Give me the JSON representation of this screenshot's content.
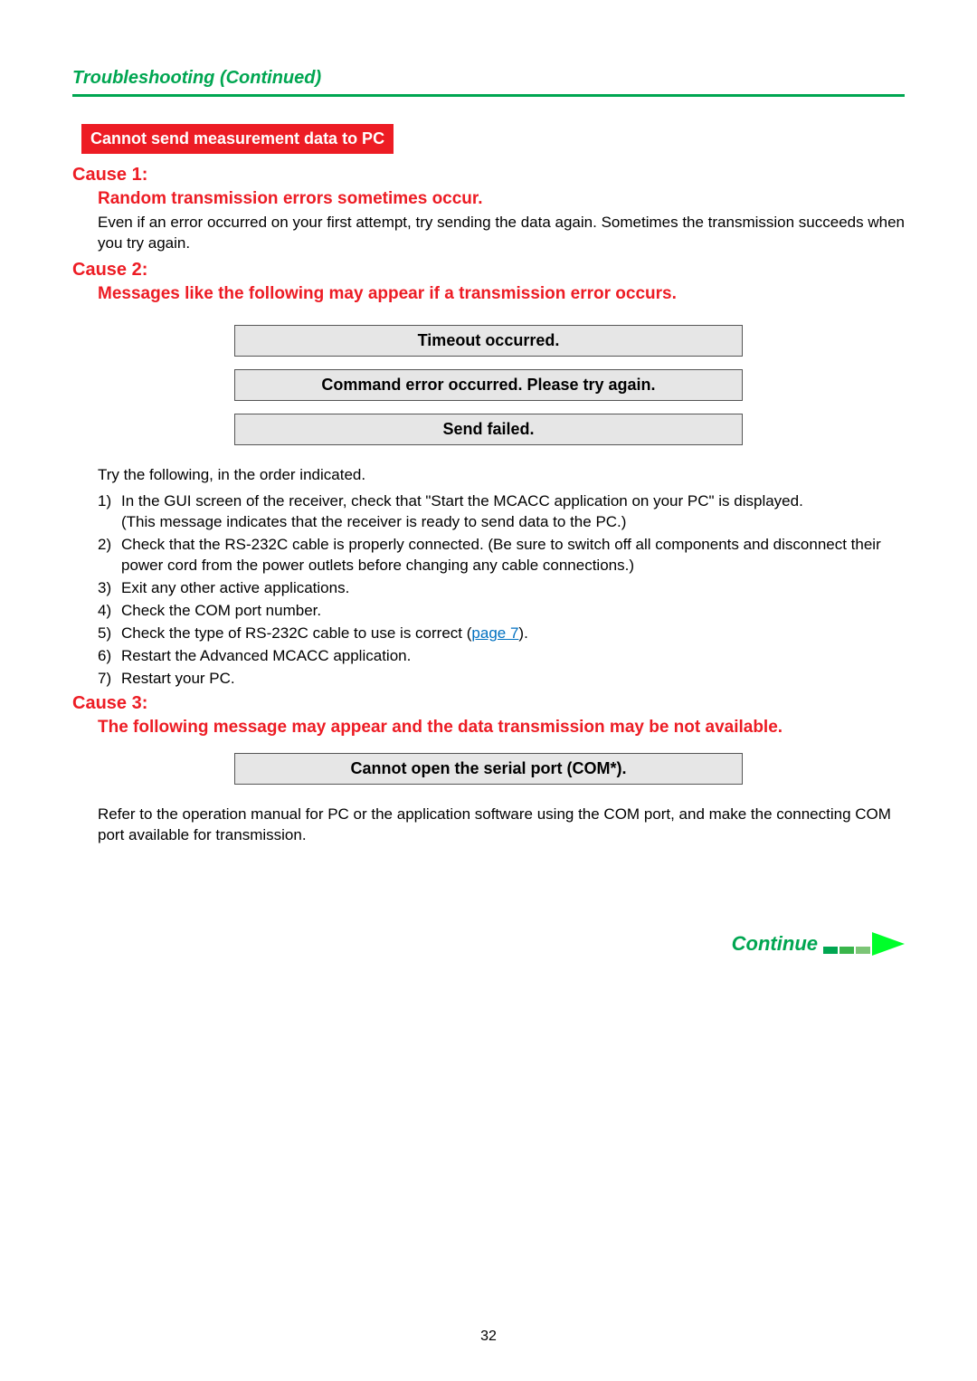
{
  "header": {
    "breadcrumb": "Troubleshooting (Continued)"
  },
  "section": {
    "title": "Cannot send measurement data to PC"
  },
  "cause1": {
    "label": "Cause 1:",
    "sub": "Random transmission errors sometimes occur.",
    "body": "Even if an error occurred on your first attempt, try sending the data again. Sometimes the transmission succeeds when you try again."
  },
  "cause2": {
    "label": "Cause 2:",
    "sub": "Messages like the following may appear if a transmission error occurs.",
    "msgs": [
      "Timeout occurred.",
      "Command error occurred. Please try again.",
      "Send failed."
    ],
    "intro": "Try the following, in the order indicated.",
    "items": [
      {
        "n": "1)",
        "text_a": "In the GUI screen of the receiver, check that \"Start the MCACC application on your PC\" is displayed.",
        "text_b": "(This message indicates that the receiver is ready to send data to the PC.)"
      },
      {
        "n": "2)",
        "text_a": "Check that the RS-232C cable is properly connected. (Be sure to switch off all components and disconnect their power cord from the power outlets before changing any cable connections.)"
      },
      {
        "n": "3)",
        "text_a": "Exit any other active applications."
      },
      {
        "n": "4)",
        "text_a": "Check the COM port number."
      },
      {
        "n": "5)",
        "text_a": "Check the type of RS-232C cable to use is correct (",
        "link": "page 7",
        "text_c": ")."
      },
      {
        "n": "6)",
        "text_a": "Restart the Advanced MCACC application."
      },
      {
        "n": "7)",
        "text_a": "Restart your PC."
      }
    ]
  },
  "cause3": {
    "label": "Cause 3:",
    "sub": "The following message may appear and the data transmission may be not available.",
    "msg": "Cannot open the serial port (COM*).",
    "body": "Refer to the operation manual for PC or the application software using the COM port, and make the connecting COM port available for transmission."
  },
  "footer": {
    "continue": "Continue",
    "page": "32"
  }
}
